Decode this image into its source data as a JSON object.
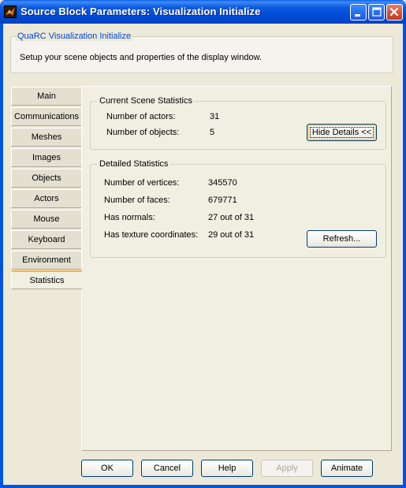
{
  "window": {
    "title": "Source Block Parameters: Visualization Initialize"
  },
  "header": {
    "group_title": "QuaRC Visualization Initialize",
    "description": "Setup your scene objects and properties of the display window."
  },
  "tabs": [
    {
      "label": "Main"
    },
    {
      "label": "Communications"
    },
    {
      "label": "Meshes"
    },
    {
      "label": "Images"
    },
    {
      "label": "Objects"
    },
    {
      "label": "Actors"
    },
    {
      "label": "Mouse"
    },
    {
      "label": "Keyboard"
    },
    {
      "label": "Environment"
    },
    {
      "label": "Statistics"
    }
  ],
  "active_tab": "Statistics",
  "scene_stats": {
    "title": "Current Scene Statistics",
    "actors_label": "Number of actors:",
    "actors_value": "31",
    "objects_label": "Number of objects:",
    "objects_value": "5",
    "hide_details_label": "Hide Details <<"
  },
  "detailed_stats": {
    "title": "Detailed Statistics",
    "vertices_label": "Number of vertices:",
    "vertices_value": "345570",
    "faces_label": "Number of faces:",
    "faces_value": "679771",
    "normals_label": "Has normals:",
    "normals_value": "27 out of 31",
    "texcoords_label": "Has texture coordinates:",
    "texcoords_value": "29 out of 31",
    "refresh_label": "Refresh..."
  },
  "footer": {
    "ok_label": "OK",
    "cancel_label": "Cancel",
    "help_label": "Help",
    "apply_label": "Apply",
    "animate_label": "Animate"
  },
  "colors": {
    "titlebar": "#0054E3",
    "dialog_bg": "#ECE9D8",
    "header_legend": "#0046D5",
    "active_tab_accent": "#F4B73D"
  }
}
